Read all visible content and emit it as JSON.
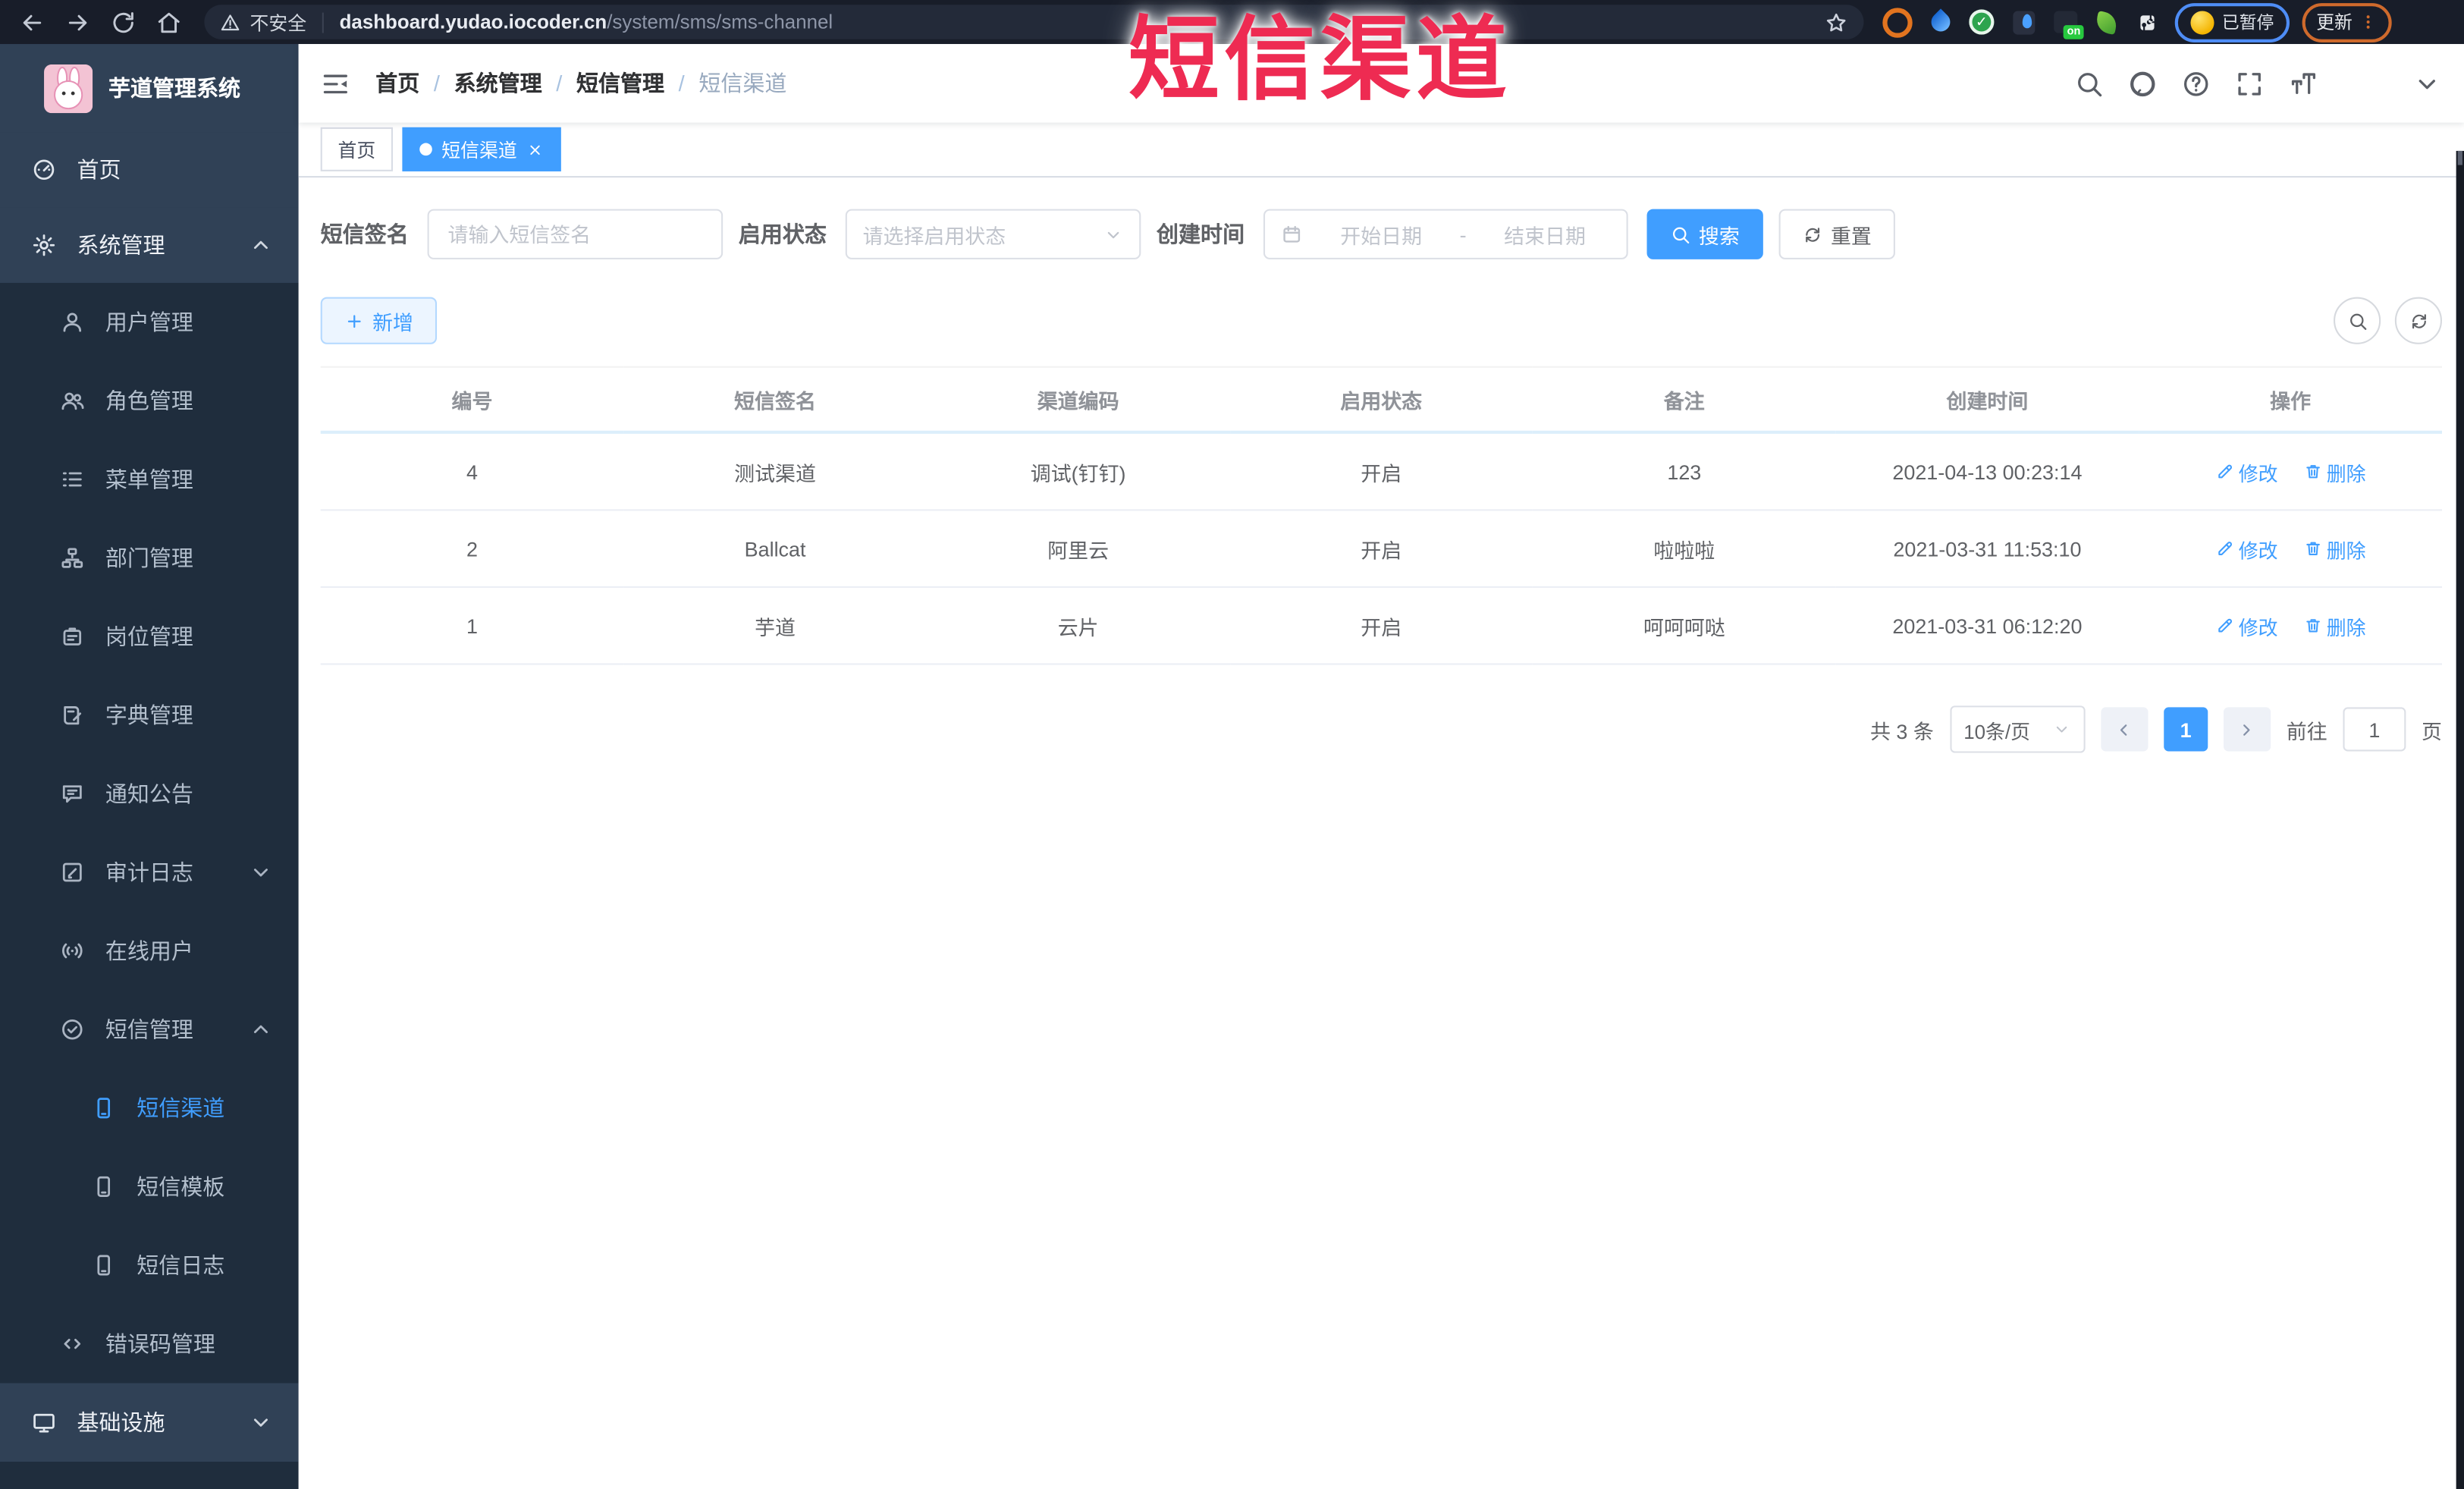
{
  "overlay": {
    "title": "短信渠道"
  },
  "browser": {
    "security_label": "不安全",
    "url_host": "dashboard.yudao.iocoder.cn",
    "url_path": "/system/sms/sms-channel",
    "paused_badge": "已暂停",
    "update_button": "更新",
    "icons": {
      "back": "arrow-left",
      "forward": "arrow-right",
      "reload": "reload",
      "home": "home",
      "security": "warning-triangle",
      "bookmark": "star",
      "extensions": "puzzle",
      "menu": "kebab"
    }
  },
  "header": {
    "breadcrumb": [
      "首页",
      "系统管理",
      "短信管理",
      "短信渠道"
    ],
    "separator": "/",
    "icons": {
      "collapse": "hamburger",
      "search": "search",
      "github": "github",
      "help": "question",
      "fullscreen": "fullscreen",
      "font_size": "font-size",
      "user_caret": "chevron-down"
    }
  },
  "sidebar": {
    "logo_title": "芋道管理系统",
    "items": [
      {
        "label": "首页",
        "icon": "gauge"
      },
      {
        "label": "系统管理",
        "icon": "gear",
        "caret": "chevron-up"
      },
      {
        "label": "用户管理",
        "icon": "user"
      },
      {
        "label": "角色管理",
        "icon": "user-group"
      },
      {
        "label": "菜单管理",
        "icon": "menu-list"
      },
      {
        "label": "部门管理",
        "icon": "org-tree"
      },
      {
        "label": "岗位管理",
        "icon": "id-badge"
      },
      {
        "label": "字典管理",
        "icon": "dictionary-book"
      },
      {
        "label": "通知公告",
        "icon": "announcement-bubble"
      },
      {
        "label": "审计日志",
        "icon": "audit-edit",
        "caret": "chevron-down"
      },
      {
        "label": "在线用户",
        "icon": "broadcast-signal"
      },
      {
        "label": "短信管理",
        "icon": "seal-check",
        "caret": "chevron-up"
      },
      {
        "label": "短信渠道",
        "icon": "mobile-phone",
        "active": true
      },
      {
        "label": "短信模板",
        "icon": "mobile-phone"
      },
      {
        "label": "短信日志",
        "icon": "mobile-phone"
      },
      {
        "label": "错误码管理",
        "icon": "code-brackets"
      },
      {
        "label": "基础设施",
        "icon": "monitor",
        "caret": "chevron-down"
      }
    ]
  },
  "tabs": [
    {
      "label": "首页"
    },
    {
      "label": "短信渠道",
      "active": true
    }
  ],
  "filters": {
    "sign_label": "短信签名",
    "sign_placeholder": "请输入短信签名",
    "status_label": "启用状态",
    "status_placeholder": "请选择启用状态",
    "date_label": "创建时间",
    "date_start": "开始日期",
    "date_sep": "-",
    "date_end": "结束日期",
    "search_label": "搜索",
    "reset_label": "重置"
  },
  "toolbar": {
    "add_label": "新增"
  },
  "table": {
    "headers": [
      "编号",
      "短信签名",
      "渠道编码",
      "启用状态",
      "备注",
      "创建时间",
      "操作"
    ],
    "rows": [
      {
        "cells": [
          "4",
          "测试渠道",
          "调试(钉钉)",
          "开启",
          "123",
          "2021-04-13 00:23:14"
        ]
      },
      {
        "cells": [
          "2",
          "Ballcat",
          "阿里云",
          "开启",
          "啦啦啦",
          "2021-03-31 11:53:10"
        ]
      },
      {
        "cells": [
          "1",
          "芋道",
          "云片",
          "开启",
          "呵呵呵哒",
          "2021-03-31 06:12:20"
        ]
      }
    ],
    "actions": [
      {
        "label": "修改",
        "icon": "edit-pen"
      },
      {
        "label": "删除",
        "icon": "trash"
      }
    ]
  },
  "pagination": {
    "total": "共 3 条",
    "page_size": "10条/页",
    "current_page": "1",
    "jump_prefix": "前往",
    "jump_value": "1",
    "jump_suffix": "页"
  },
  "ui_icons": {
    "select_caret": "chevron-down",
    "date_icon": "calendar",
    "search_btn": "search",
    "reset_btn": "refresh",
    "add_btn": "plus",
    "tool_search": "search",
    "tool_refresh": "refresh",
    "tab_close": "close",
    "pager_prev": "chevron-left",
    "pager_next": "chevron-right",
    "pager_caret": "chevron-down"
  },
  "colors": {
    "accent": "#409eff",
    "sidebar_bg": "#304156",
    "submenu_bg": "#1f2d3d",
    "overlay_red": "#ee2b52"
  }
}
